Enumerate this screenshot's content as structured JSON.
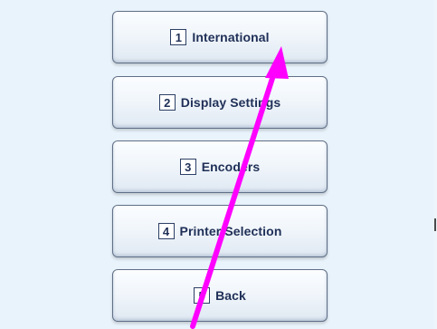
{
  "menu": {
    "items": [
      {
        "key": "1",
        "label": "International"
      },
      {
        "key": "2",
        "label": "Display Settings"
      },
      {
        "key": "3",
        "label": "Encoders"
      },
      {
        "key": "4",
        "label": "Printer Selection"
      },
      {
        "key": "5",
        "label": "Back"
      }
    ]
  },
  "colors": {
    "background": "#e9f3fb",
    "button_text": "#1f2f57",
    "button_border": "#5e6e86",
    "annotation_arrow": "#ff00ff"
  },
  "annotation": {
    "type": "arrow",
    "points_to": "International"
  }
}
